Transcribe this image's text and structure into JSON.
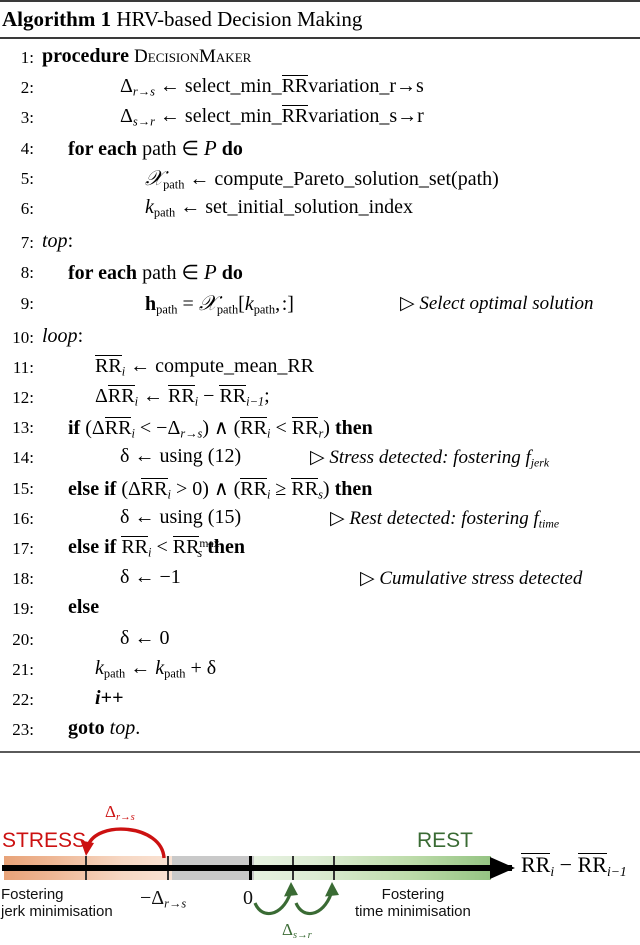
{
  "algorithm": {
    "label": "Algorithm 1",
    "title": "HRV-based Decision Making",
    "lines": [
      {
        "n": "1:",
        "text": "procedure DecisionMaker"
      },
      {
        "n": "2:",
        "text": "Δ_{r→s} ← select_min_RRvariation_r→s"
      },
      {
        "n": "3:",
        "text": "Δ_{s→r} ← select_min_RRvariation_s→r"
      },
      {
        "n": "4:",
        "text": "for each path ∈ P do"
      },
      {
        "n": "5:",
        "text": "X_path ← compute_Pareto_solution_set(path)"
      },
      {
        "n": "6:",
        "text": "k_path ← set_initial_solution_index"
      },
      {
        "n": "7:",
        "text": "top:"
      },
      {
        "n": "8:",
        "text": "for each path ∈ P do"
      },
      {
        "n": "9:",
        "text": "h_path = X_path[k_path , :]",
        "comment": "▷ Select optimal solution"
      },
      {
        "n": "10:",
        "text": "loop:"
      },
      {
        "n": "11:",
        "text": "RR_i ← compute_mean_RR"
      },
      {
        "n": "12:",
        "text": "ΔRR_i ← RR_i − RR_{i−1};"
      },
      {
        "n": "13:",
        "text": "if (ΔRR_i < −Δ_{r→s}) ∧ (RR_i < RR_r) then"
      },
      {
        "n": "14:",
        "text": "δ ← using (12)",
        "comment": "▷ Stress detected: fostering f_jerk"
      },
      {
        "n": "15:",
        "text": "else if (ΔRR_i > 0) ∧ (RR_i ≥ RR_s) then"
      },
      {
        "n": "16:",
        "text": "δ ← using (15)",
        "comment": "▷ Rest detected: fostering f_time"
      },
      {
        "n": "17:",
        "text": "else if RR_i < RR_s^max then"
      },
      {
        "n": "18:",
        "text": "δ ← −1",
        "comment": "▷ Cumulative stress detected"
      },
      {
        "n": "19:",
        "text": "else"
      },
      {
        "n": "20:",
        "text": "δ ← 0"
      },
      {
        "n": "21:",
        "text": "k_path ← k_path + δ"
      },
      {
        "n": "22:",
        "text": "i++"
      },
      {
        "n": "23:",
        "text": "goto top."
      }
    ],
    "keywords": {
      "procedure": "procedure",
      "proc_name": "DecisionMaker",
      "for_each": "for each",
      "path": "path",
      "in_set": "∈",
      "calP": "P",
      "do": "do",
      "top": "top",
      "loop": "loop",
      "if": "if",
      "else_if": "else if",
      "else": "else",
      "then": "then",
      "goto": "goto",
      "arrow": "←",
      "select_min": "select_min_",
      "variation_rs": "variation_r→s",
      "variation_sr": "variation_s→r",
      "compute_pareto": "compute_Pareto_solution_set(path)",
      "set_initial": "set_initial_solution_index",
      "compute_mean": "compute_mean_RR",
      "using12": "using (12)",
      "using15": "using (15)",
      "minus_one": "−1",
      "zero": "0",
      "iplusplus": "i++",
      "period": ".",
      "semicolon": ";"
    },
    "comments": {
      "select_optimal": "Select optimal solution",
      "stress_detected": "Stress detected: fostering",
      "rest_detected": "Rest detected: fostering",
      "cumulative": "Cumulative stress detected",
      "f_jerk_base": "f",
      "f_jerk_sub": "jerk",
      "f_time_sub": "time",
      "marker": "▷"
    }
  },
  "diagram": {
    "stress_label": "STRESS",
    "rest_label": "REST",
    "left_caption_line1": "Fostering",
    "left_caption_line2": "jerk minimisation",
    "right_caption_line1": "Fostering",
    "right_caption_line2": "time minimisation",
    "tick_label_neg_delta": "−Δ",
    "tick_label_neg_delta_sub": "r→s",
    "tick_label_zero": "0",
    "red_arc_label": "Δ",
    "red_arc_label_sub": "r→s",
    "green_arc_label": "Δ",
    "green_arc_label_sub": "s→r",
    "axis_label": "RR_i − RR_{i−1}",
    "colors": {
      "stress_text": "#cc1111",
      "rest_text": "#3a6b34",
      "red_arc": "#cc1111",
      "green_arc": "#3a6b34",
      "orange": "#e8a379",
      "orange_light": "#f8ddcc",
      "grey": "#c9c9c9",
      "green_light": "#e3f0dc",
      "green": "#95c483",
      "axis": "#000000"
    }
  }
}
